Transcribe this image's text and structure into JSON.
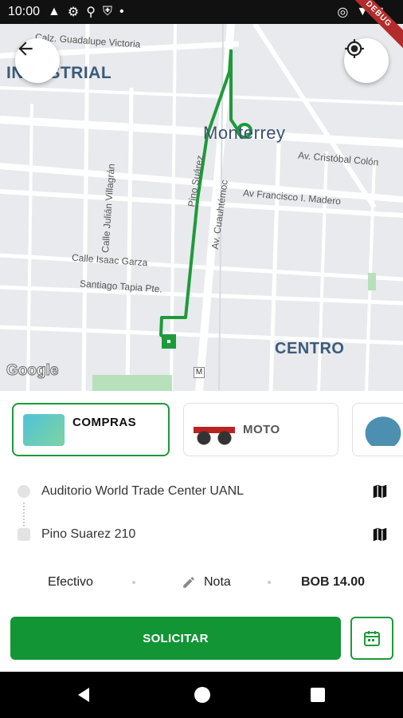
{
  "status_bar": {
    "time": "10:00",
    "debug_label": "DEBUG"
  },
  "map": {
    "streets": [
      "Calz. Guadalupe Victoria",
      "Av. Cristóbal Colón",
      "Pino Suárez",
      "Av Francisco I. Madero",
      "Av. Cuauhtémoc",
      "Calle Julián Villagrán",
      "Calle Isaac Garza",
      "Santiago Tapia Pte."
    ],
    "areas": {
      "industrial": "INDUSTRIAL",
      "monterrey": "Monterrey",
      "centro": "CENTRO"
    },
    "google_logo": "Google",
    "metro_badge": "M",
    "route_color": "#1e9a3b"
  },
  "controls": {
    "back_icon": "arrow-left-icon",
    "locate_icon": "my-location-icon"
  },
  "services": [
    {
      "label": "COMPRAS",
      "selected": true
    },
    {
      "label": "MOTO",
      "selected": false
    },
    {
      "label": "",
      "selected": false
    }
  ],
  "route": {
    "origin": "Auditorio World Trade Center UANL",
    "destination": "Pino Suarez 210"
  },
  "options": {
    "payment": "Efectivo",
    "note": "Nota",
    "price": "BOB 14.00"
  },
  "actions": {
    "request": "SOLICITAR"
  },
  "colors": {
    "primary": "#129535"
  }
}
